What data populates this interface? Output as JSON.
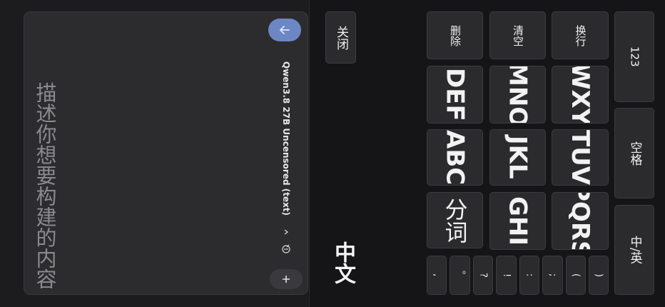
{
  "compose": {
    "placeholder": "描述你想要构建的内容",
    "model": "Qwen3.8 27B Uncensored (text)"
  },
  "keyboard": {
    "close_label": "关闭",
    "language_label": "中文",
    "actions": {
      "delete": "删除",
      "clear": "清空",
      "newline": "换行",
      "numeric": "123",
      "space": "空格",
      "lang_switch": "中/英",
      "segment": "分词"
    },
    "letters": [
      "DEF",
      "MNO",
      "WXY",
      "ABC",
      "JKL",
      "TUV",
      "GHI",
      "PQRS"
    ],
    "punctuation": [
      ",",
      "。",
      "?",
      "!",
      ":",
      ";",
      "(",
      ")"
    ]
  },
  "colors": {
    "accent": "#6c87c4",
    "panel": "#2c2c2f",
    "key": "#2b2b2e",
    "background": "#151517"
  }
}
